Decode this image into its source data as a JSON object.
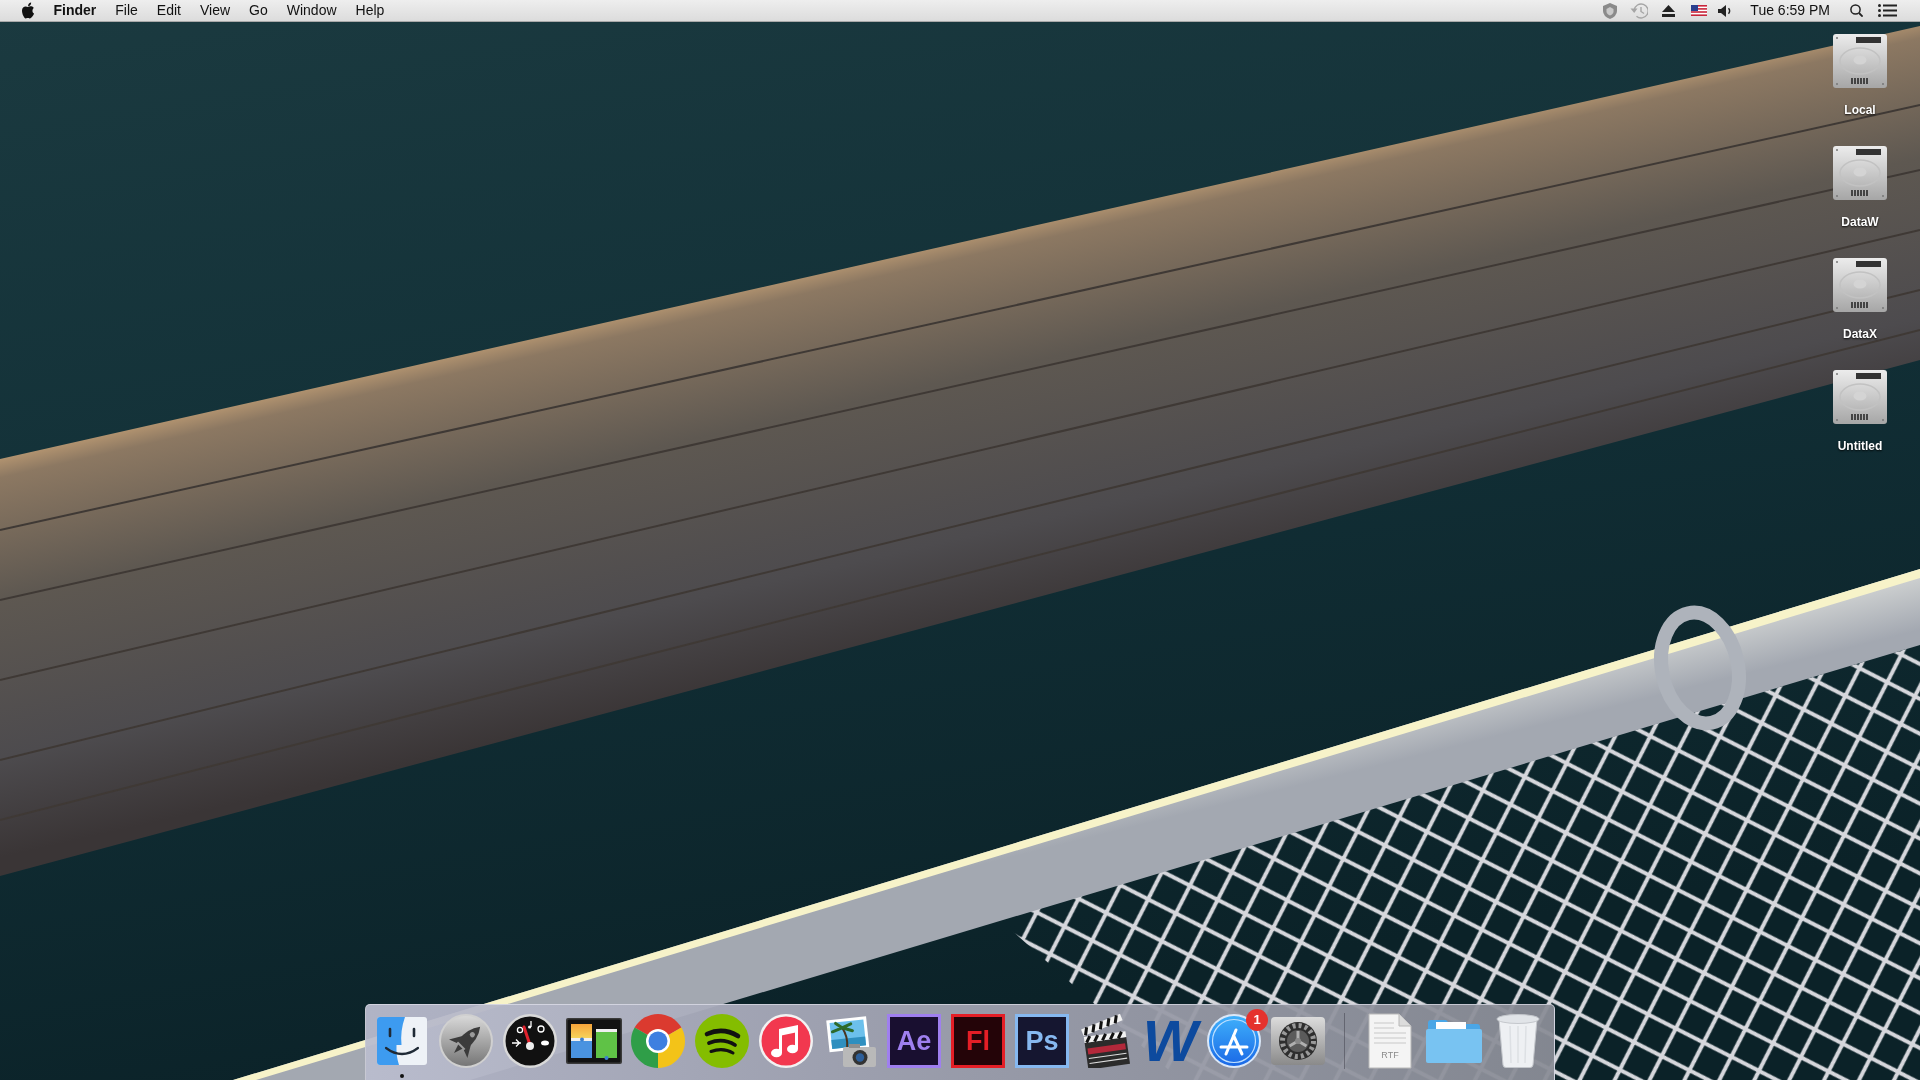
{
  "menu_bar": {
    "app_name": "Finder",
    "menus": [
      "File",
      "Edit",
      "View",
      "Go",
      "Window",
      "Help"
    ],
    "clock": "Tue 6:59 PM"
  },
  "desktop_icons": [
    {
      "label": "Local"
    },
    {
      "label": "DataW"
    },
    {
      "label": "DataX"
    },
    {
      "label": "Untitled"
    }
  ],
  "dock": {
    "apps": [
      {
        "kind": "face",
        "running": true
      },
      {
        "kind": "rocket",
        "running": false
      },
      {
        "kind": "gauge",
        "running": false
      },
      {
        "kind": "windows",
        "running": false
      },
      {
        "kind": "ring",
        "running": false
      },
      {
        "kind": "waves",
        "running": false
      },
      {
        "kind": "note",
        "running": false
      },
      {
        "kind": "photo",
        "running": false
      },
      {
        "kind": "tile",
        "glyph": "Ae",
        "color": "#9f7fef",
        "running": false
      },
      {
        "kind": "tile",
        "glyph": "Fl",
        "color": "#e41e26",
        "running": false
      },
      {
        "kind": "tile",
        "glyph": "Ps",
        "color": "#86b8f0",
        "running": false
      },
      {
        "kind": "clapper",
        "running": false
      },
      {
        "kind": "logo",
        "glyph": "W",
        "running": false
      },
      {
        "kind": "store",
        "badge": "1",
        "running": false
      },
      {
        "kind": "gear",
        "running": false
      }
    ],
    "stacks": [
      {
        "kind": "document",
        "glyph": "RTF"
      },
      {
        "kind": "folder"
      },
      {
        "kind": "trash"
      }
    ]
  }
}
